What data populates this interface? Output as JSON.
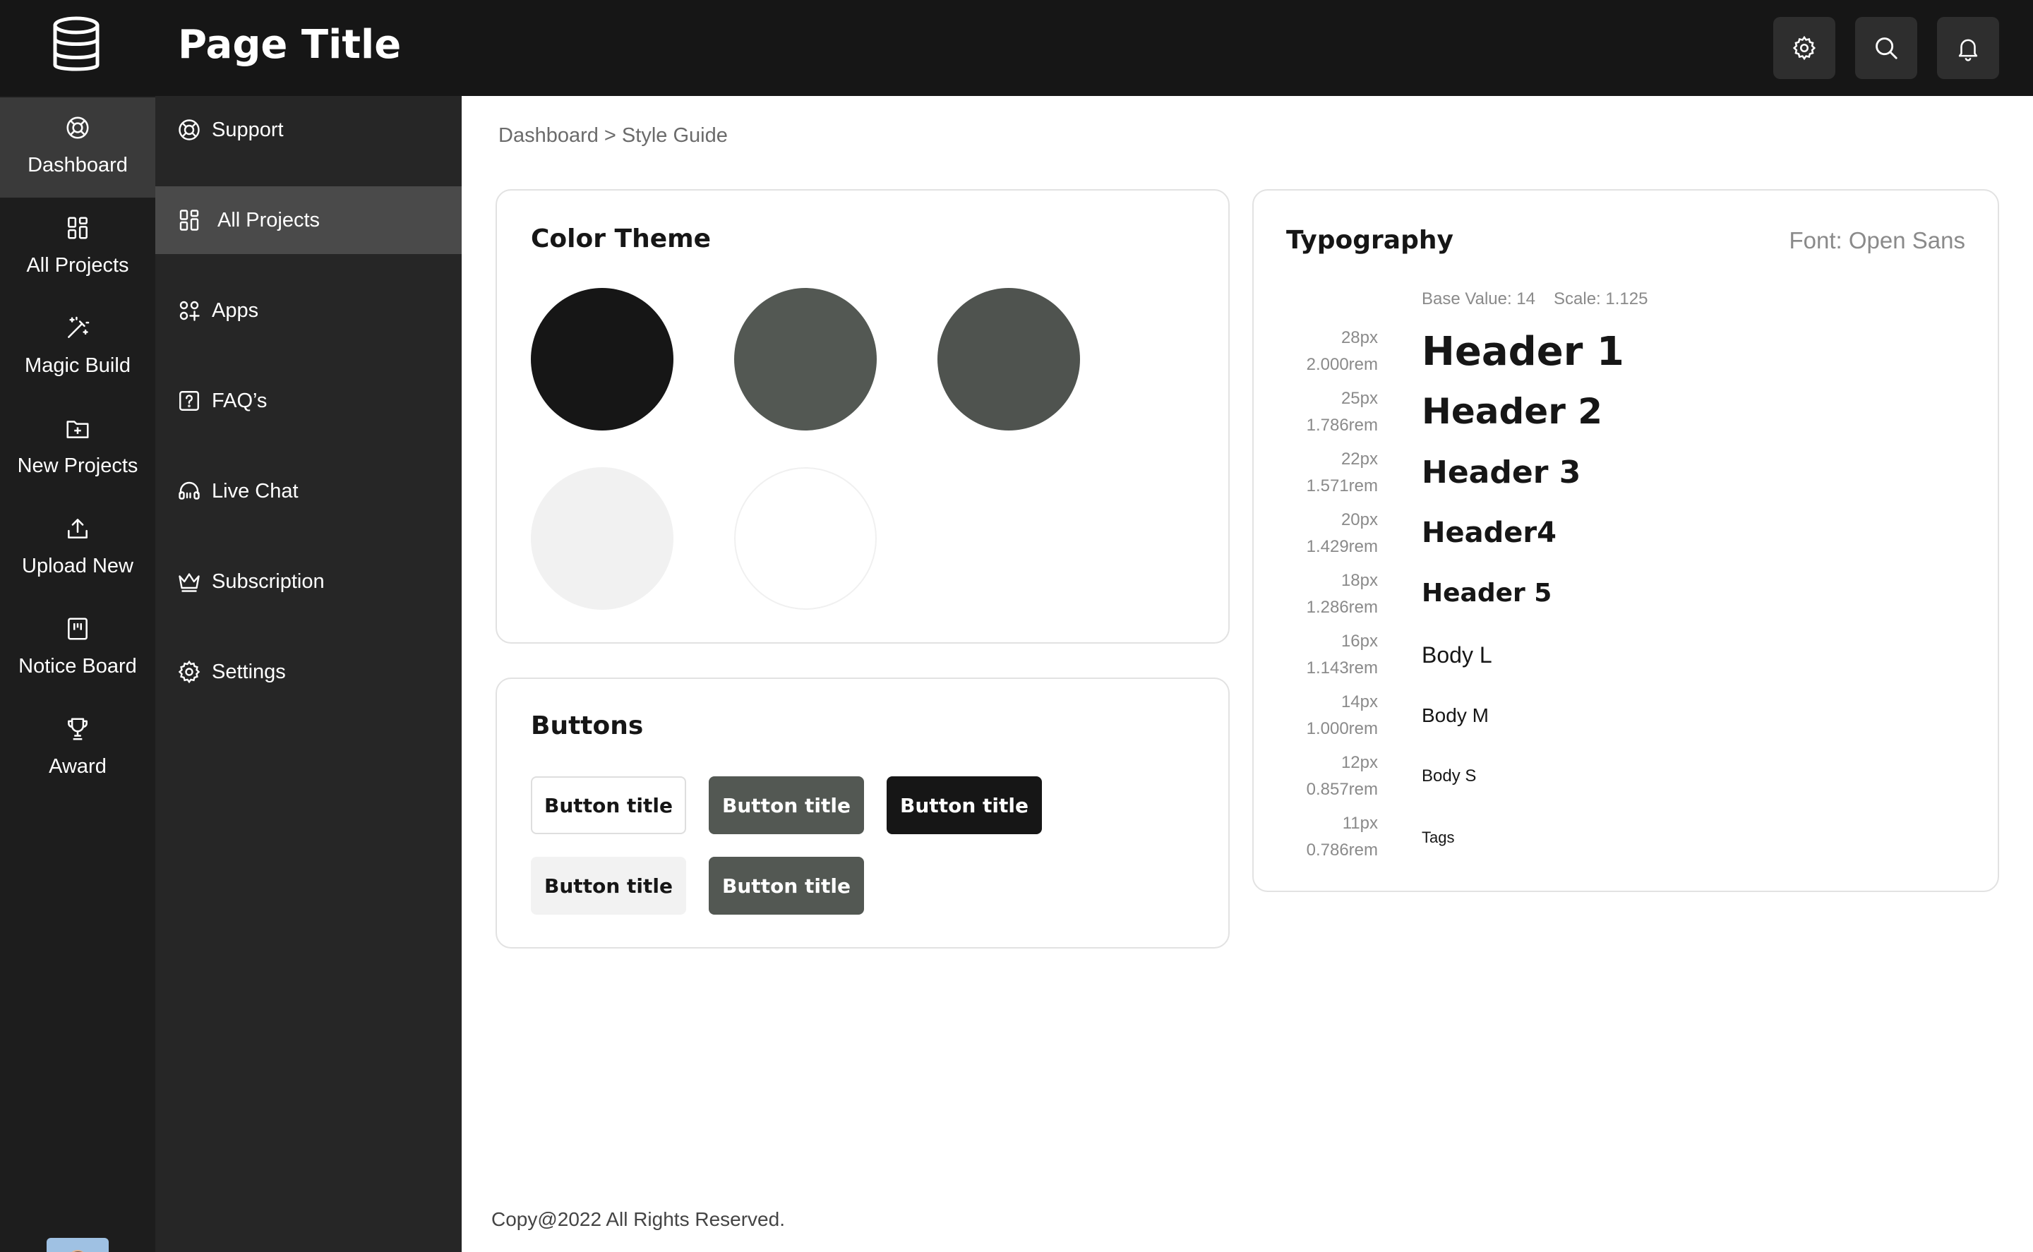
{
  "header": {
    "title": "Page Title",
    "logo_icon": "database-icon",
    "actions": [
      {
        "icon": "gear-icon"
      },
      {
        "icon": "search-icon"
      },
      {
        "icon": "bell-icon"
      }
    ]
  },
  "rail": {
    "items": [
      {
        "label": "Dashboard",
        "icon": "lifebuoy-icon",
        "active": true
      },
      {
        "label": "All Projects",
        "icon": "grid-icon",
        "active": false
      },
      {
        "label": "Magic Build",
        "icon": "magic-wand-icon",
        "active": false
      },
      {
        "label": "New Projects",
        "icon": "folder-plus-icon",
        "active": false
      },
      {
        "label": "Upload New",
        "icon": "upload-icon",
        "active": false
      },
      {
        "label": "Notice Board",
        "icon": "notice-board-icon",
        "active": false
      },
      {
        "label": "Award",
        "icon": "trophy-icon",
        "active": false
      }
    ],
    "avatar_icon": "user-avatar"
  },
  "subnav": {
    "items": [
      {
        "label": "Support",
        "icon": "lifebuoy-icon",
        "active": false
      },
      {
        "label": "All Projects",
        "icon": "grid-icon",
        "active": true
      },
      {
        "label": "Apps",
        "icon": "apps-icon",
        "active": false
      },
      {
        "label": "FAQ’s",
        "icon": "question-icon",
        "active": false
      },
      {
        "label": "Live Chat",
        "icon": "headset-icon",
        "active": false
      },
      {
        "label": "Subscription",
        "icon": "crown-icon",
        "active": false
      },
      {
        "label": "Settings",
        "icon": "gear-icon",
        "active": false
      }
    ]
  },
  "breadcrumb": "Dashboard > Style Guide",
  "color_theme": {
    "title": "Color Theme",
    "swatches": [
      "#161616",
      "#535853",
      "#4f534f",
      "#f1f1f1",
      "#ffffff"
    ]
  },
  "buttons": {
    "title": "Buttons",
    "items": [
      {
        "label": "Button title",
        "style": "outline"
      },
      {
        "label": "Button title",
        "style": "gray"
      },
      {
        "label": "Button title",
        "style": "dark"
      },
      {
        "label": "Button title",
        "style": "light"
      },
      {
        "label": "Button title",
        "style": "gray"
      }
    ]
  },
  "typography": {
    "title": "Typography",
    "font_label": "Font: Open Sans",
    "base_value": "Base Value: 14",
    "scale": "Scale: 1.125",
    "rows": [
      {
        "px": "28px",
        "rem": "2.000rem",
        "sample": "Header 1"
      },
      {
        "px": "25px",
        "rem": "1.786rem",
        "sample": "Header 2"
      },
      {
        "px": "22px",
        "rem": "1.571rem",
        "sample": "Header 3"
      },
      {
        "px": "20px",
        "rem": "1.429rem",
        "sample": "Header4"
      },
      {
        "px": "18px",
        "rem": "1.286rem",
        "sample": "Header 5"
      },
      {
        "px": "16px",
        "rem": "1.143rem",
        "sample": "Body L"
      },
      {
        "px": "14px",
        "rem": "1.000rem",
        "sample": "Body M"
      },
      {
        "px": "12px",
        "rem": "0.857rem",
        "sample": "Body S"
      },
      {
        "px": "11px",
        "rem": "0.786rem",
        "sample": "Tags"
      }
    ]
  },
  "footer": "Copy@2022 All Rights Reserved.",
  "colors": {
    "header_bg": "#161616",
    "rail_bg": "#1d1d1d",
    "subnav_bg": "#262626",
    "accent_gray": "#535853"
  }
}
